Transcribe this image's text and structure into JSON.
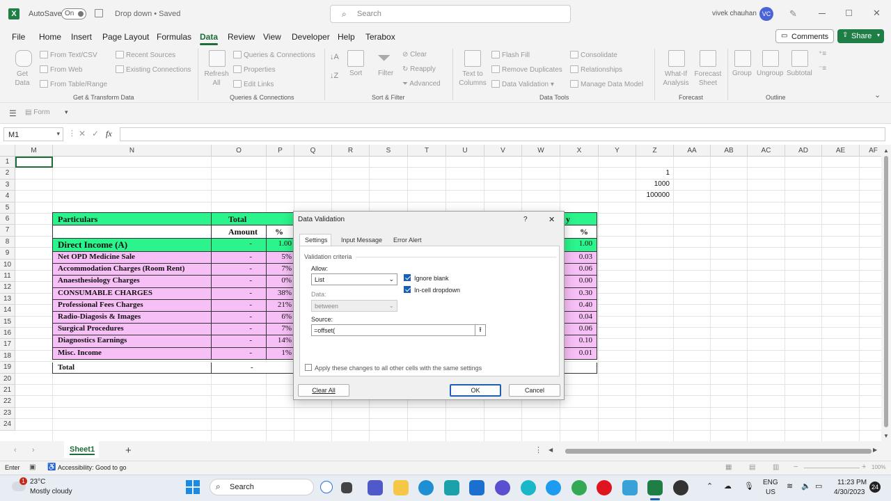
{
  "title": {
    "app_icon": "X",
    "autosave": "AutoSave",
    "toggle": "On",
    "doc": "Drop down • Saved",
    "search_placeholder": "Search",
    "user": "vivek chauhan",
    "avatar": "VC"
  },
  "menu": {
    "tabs": [
      "File",
      "Home",
      "Insert",
      "Page Layout",
      "Formulas",
      "Data",
      "Review",
      "View",
      "Developer",
      "Help",
      "Terabox"
    ],
    "active": "Data",
    "comments": "Comments",
    "share": "Share"
  },
  "ribbon": {
    "get_data": "Get Data",
    "from_text_csv": "From Text/CSV",
    "from_web": "From Web",
    "from_table_range": "From Table/Range",
    "recent_sources": "Recent Sources",
    "existing_connections": "Existing Connections",
    "group_get_transform": "Get & Transform Data",
    "refresh_all": "Refresh All",
    "queries_connections": "Queries & Connections",
    "properties": "Properties",
    "edit_links": "Edit Links",
    "group_queries": "Queries & Connections",
    "sort": "Sort",
    "filter": "Filter",
    "clear": "Clear",
    "reapply": "Reapply",
    "advanced": "Advanced",
    "group_sort_filter": "Sort & Filter",
    "text_to_columns": "Text to Columns",
    "flash_fill": "Flash Fill",
    "remove_duplicates": "Remove Duplicates",
    "data_validation": "Data Validation",
    "consolidate": "Consolidate",
    "relationships": "Relationships",
    "manage_data_model": "Manage Data Model",
    "group_data_tools": "Data Tools",
    "what_if": "What-If Analysis",
    "forecast_sheet": "Forecast Sheet",
    "group_forecast": "Forecast",
    "group": "Group",
    "ungroup": "Ungroup",
    "subtotal": "Subtotal",
    "group_outline": "Outline"
  },
  "formbar": {
    "form": "Form"
  },
  "fx": {
    "name_box": "M1",
    "fx": "fx"
  },
  "columns": [
    "M",
    "N",
    "O",
    "P",
    "Q",
    "R",
    "S",
    "T",
    "U",
    "V",
    "W",
    "X",
    "Y",
    "Z",
    "AA",
    "AB",
    "AC",
    "AD",
    "AE",
    "AF"
  ],
  "rows": [
    "1",
    "2",
    "3",
    "4",
    "5",
    "6",
    "7",
    "8",
    "9",
    "10",
    "11",
    "12",
    "13",
    "14",
    "15",
    "16",
    "17",
    "18",
    "19",
    "20",
    "21",
    "22",
    "23",
    "24"
  ],
  "sheet": {
    "z_values": [
      "1",
      "1000",
      "100000"
    ],
    "header_particulars": "Particulars",
    "header_total": "Total",
    "header_amount": "Amount",
    "header_pct": "%",
    "right_header_y": "y",
    "right_header_pct": "%",
    "items": [
      {
        "name": "Direct Income (A)",
        "amt": "-",
        "pct": "1.00",
        "right": "1.00"
      },
      {
        "name": "Net OPD Medicine Sale",
        "amt": "-",
        "pct": "5%",
        "right": "0.03"
      },
      {
        "name": "Accommodation Charges (Room Rent)",
        "amt": "-",
        "pct": "7%",
        "right": "0.06"
      },
      {
        "name": "Anaesthesiology Charges",
        "amt": "-",
        "pct": "0%",
        "right": "0.00"
      },
      {
        "name": "CONSUMABLE CHARGES",
        "amt": "-",
        "pct": "38%",
        "right": "0.30"
      },
      {
        "name": "Professional Fees Charges",
        "amt": "-",
        "pct": "21%",
        "right": "0.40"
      },
      {
        "name": "Radio-Diagosis & Images",
        "amt": "-",
        "pct": "6%",
        "right": "0.04"
      },
      {
        "name": "Surgical Procedures",
        "amt": "-",
        "pct": "7%",
        "right": "0.06"
      },
      {
        "name": "Diagnostics Earnings",
        "amt": "-",
        "pct": "14%",
        "right": "0.10"
      },
      {
        "name": "Misc. Income",
        "amt": "-",
        "pct": "1%",
        "right": "0.01"
      }
    ],
    "total_label": "Total",
    "total_amt": "-"
  },
  "dialog": {
    "title": "Data Validation",
    "help": "?",
    "close": "✕",
    "tabs": [
      "Settings",
      "Input Message",
      "Error Alert"
    ],
    "criteria": "Validation criteria",
    "allow_label": "Allow:",
    "allow_value": "List",
    "ignore_blank": "Ignore blank",
    "in_cell_dropdown": "In-cell dropdown",
    "data_label": "Data:",
    "data_value": "between",
    "source_label": "Source:",
    "source_value": "=offset(",
    "apply_all": "Apply these changes to all other cells with the same settings",
    "clear_all": "Clear All",
    "ok": "OK",
    "cancel": "Cancel"
  },
  "sheettabs": {
    "sheet1": "Sheet1",
    "add": "+"
  },
  "status": {
    "mode": "Enter",
    "accessibility": "Accessibility: Good to go",
    "zoom": "100%"
  },
  "taskbar": {
    "weather_temp": "23°C",
    "weather_desc": "Mostly cloudy",
    "weather_badge": "1",
    "search": "Search",
    "lang1": "ENG",
    "lang2": "US",
    "time": "11:23 PM",
    "date": "4/30/2023",
    "notif": "24"
  },
  "colors": {
    "accent": "#1e6c3a",
    "green_cell": "#2bf48c",
    "pink_cell": "#f6bff5",
    "share": "#1e7e45"
  }
}
